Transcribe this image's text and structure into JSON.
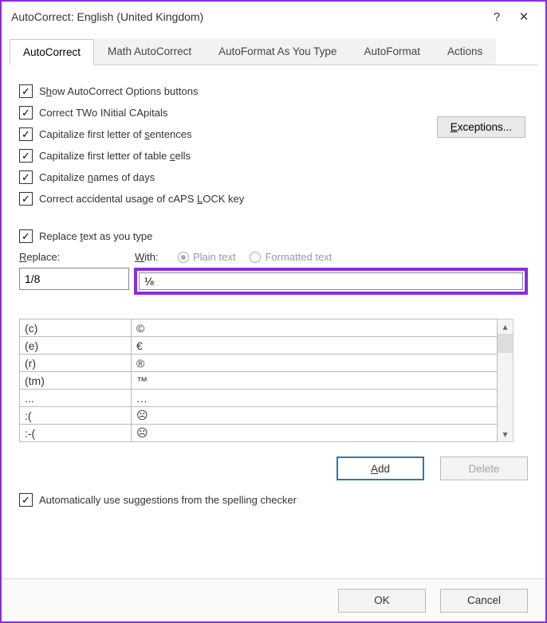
{
  "window": {
    "title": "AutoCorrect: English (United Kingdom)",
    "help": "?",
    "close": "✕"
  },
  "tabs": [
    "AutoCorrect",
    "Math AutoCorrect",
    "AutoFormat As You Type",
    "AutoFormat",
    "Actions"
  ],
  "options": {
    "show_buttons": {
      "pre": "S",
      "u": "h",
      "post": "ow AutoCorrect Options buttons"
    },
    "two_initial": {
      "text": "Correct TWo INitial CApitals"
    },
    "cap_sentence": {
      "pre": "Capitalize first letter of ",
      "u": "s",
      "post": "entences"
    },
    "cap_cells": {
      "text": "Capitalize first letter of table "
    },
    "cap_cells_u": "c",
    "cap_cells_post": "ells",
    "cap_days": {
      "pre": "Capitalize ",
      "u": "n",
      "post": "ames of days"
    },
    "caps_lock": {
      "pre": "Correct accidental usage of cAPS ",
      "u": "L",
      "post": "OCK key"
    },
    "exceptions": {
      "u": "E",
      "post": "xceptions..."
    }
  },
  "replace": {
    "replace_text": {
      "pre": "Replace ",
      "u": "t",
      "post": "ext as you type"
    },
    "replace_label": {
      "u": "R",
      "post": "eplace:"
    },
    "with_label": {
      "u": "W",
      "post": "ith:"
    },
    "plain": "Plain text",
    "formatted": "Formatted text",
    "replace_value": "1/8",
    "with_value": "⅛"
  },
  "table": [
    {
      "from": "(c)",
      "to": "©"
    },
    {
      "from": "(e)",
      "to": "€"
    },
    {
      "from": "(r)",
      "to": "®"
    },
    {
      "from": "(tm)",
      "to": "™"
    },
    {
      "from": "...",
      "to": "…"
    },
    {
      "from": ":(",
      "to": "☹"
    },
    {
      "from": ":-(",
      "to": "☹"
    }
  ],
  "buttons": {
    "add": {
      "u": "A",
      "post": "dd"
    },
    "delete": "Delete",
    "auto_sugg": "Automatically use suggestions from the spelling checker",
    "ok": "OK",
    "cancel": "Cancel"
  }
}
